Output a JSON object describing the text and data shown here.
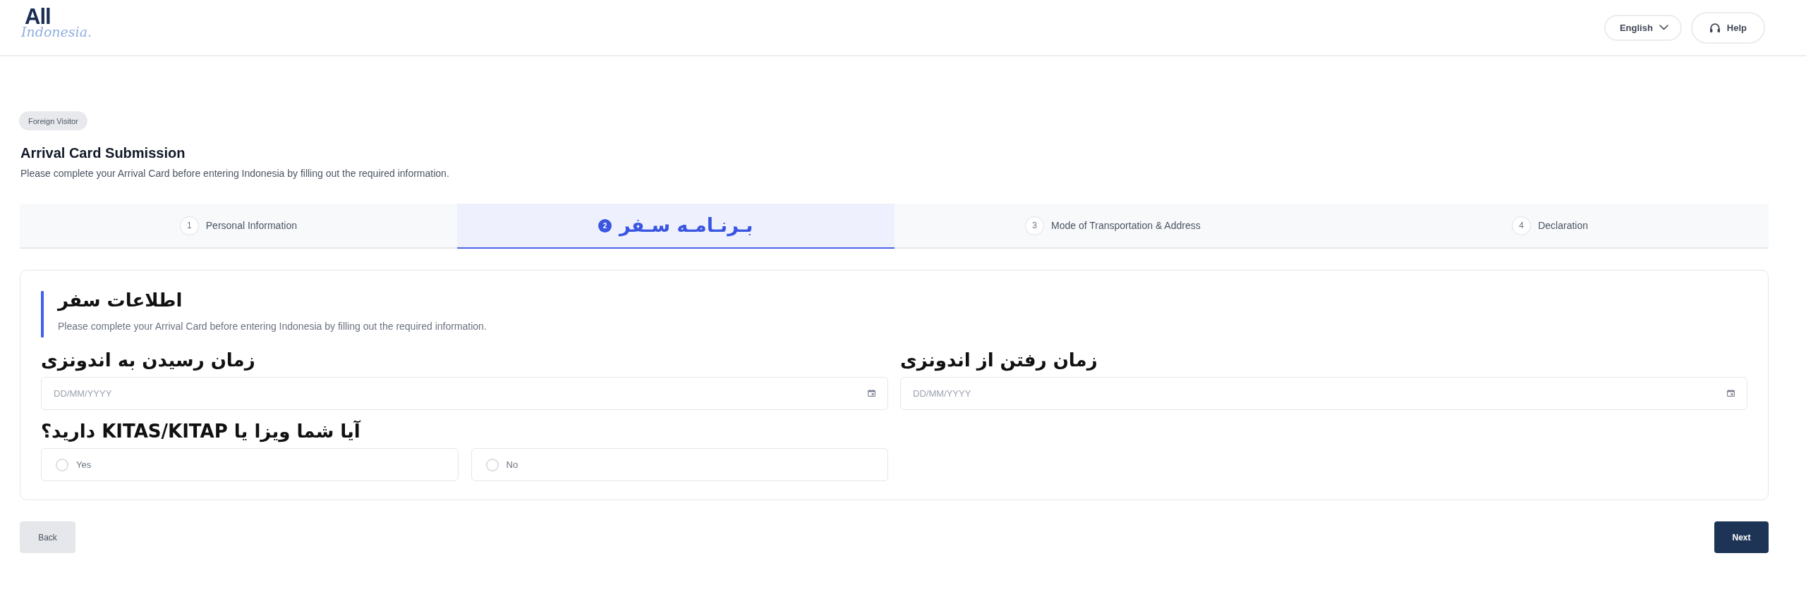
{
  "header": {
    "logo": {
      "wordmark": "All",
      "script": "Indonesia."
    },
    "language": {
      "label": "English"
    },
    "help": {
      "label": "Help"
    }
  },
  "intro": {
    "badge": "Foreign Visitor",
    "title": "Arrival Card Submission",
    "description": "Please complete your Arrival Card before entering Indonesia by filling out the required information."
  },
  "steps": [
    {
      "number": "1",
      "label": "Personal Information",
      "selected": false
    },
    {
      "number": "2",
      "label": "بـرنـامـه سـفر",
      "selected": true
    },
    {
      "number": "3",
      "label": "Mode of Transportation & Address",
      "selected": false
    },
    {
      "number": "4",
      "label": "Declaration",
      "selected": false
    }
  ],
  "section": {
    "title": "اطلاعات سفر",
    "description": "Please complete your Arrival Card before entering Indonesia by filling out the required information.",
    "arrival_date": {
      "label": "زمان رسیدن به اندونزی",
      "placeholder": "DD/MM/YYYY"
    },
    "departure_date": {
      "label": "زمان رفتن از اندونزی",
      "placeholder": "DD/MM/YYYY"
    },
    "visa_question": {
      "label": "آیا شما ویزا یا KITAS/KITAP دارید؟",
      "options": [
        {
          "label": "Yes",
          "selected": false
        },
        {
          "label": "No",
          "selected": false
        }
      ]
    }
  },
  "actions": {
    "back": {
      "label": "Back"
    },
    "next": {
      "label": "Next"
    }
  }
}
